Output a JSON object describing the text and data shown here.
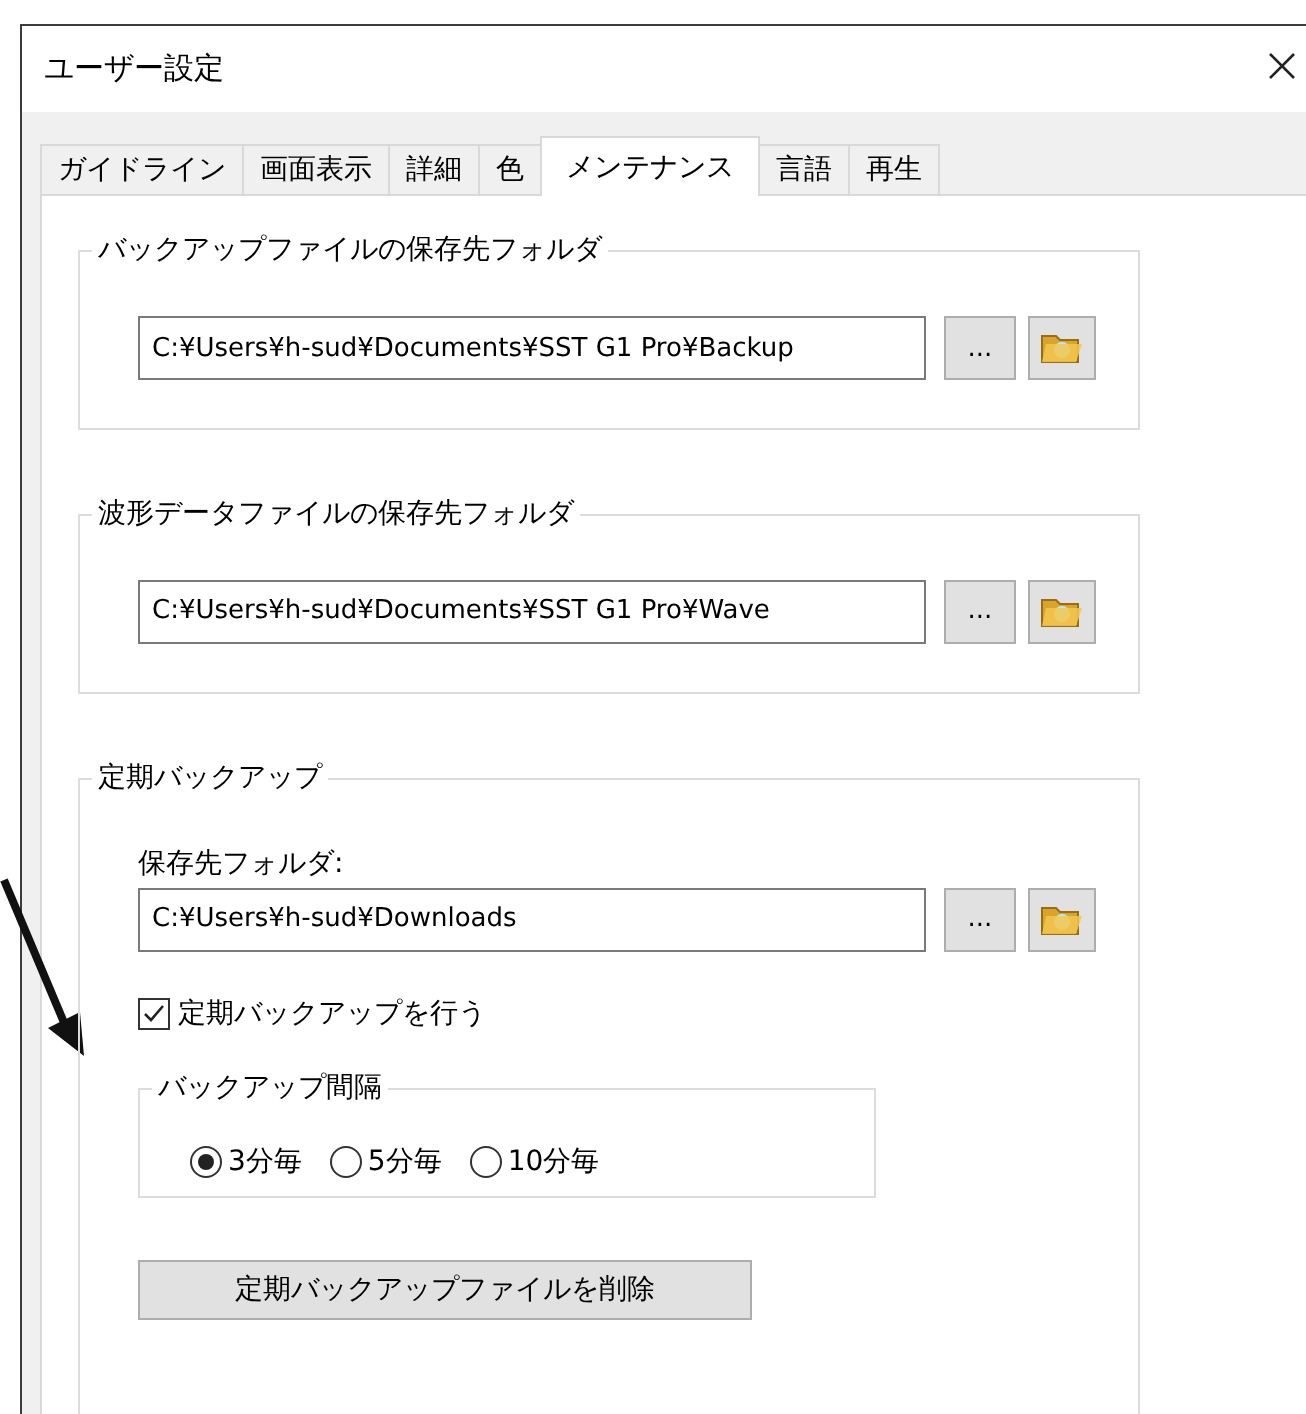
{
  "window": {
    "title": "ユーザー設定"
  },
  "tabs": [
    {
      "label": "ガイドライン",
      "selected": false
    },
    {
      "label": "画面表示",
      "selected": false
    },
    {
      "label": "詳細",
      "selected": false
    },
    {
      "label": "色",
      "selected": false
    },
    {
      "label": "メンテナンス",
      "selected": true
    },
    {
      "label": "言語",
      "selected": false
    },
    {
      "label": "再生",
      "selected": false
    }
  ],
  "groups": [
    {
      "kind": "path",
      "title": "バックアップファイルの保存先フォルダ",
      "path": "C:¥Users¥h-sud¥Documents¥SST G1 Pro¥Backup",
      "browse_button": "..."
    },
    {
      "kind": "path",
      "title": "波形データファイルの保存先フォルダ",
      "path": "C:¥Users¥h-sud¥Documents¥SST G1 Pro¥Wave",
      "browse_button": "..."
    },
    {
      "kind": "backup",
      "title": "定期バックアップ",
      "folder_label": "保存先フォルダ:",
      "path": "C:¥Users¥h-sud¥Downloads",
      "browse_button": "...",
      "enabled_label": "定期バックアップを行う",
      "enabled": true,
      "interval": {
        "title": "バックアップ間隔",
        "options": [
          {
            "label": "3分毎",
            "selected": true
          },
          {
            "label": "5分毎",
            "selected": false
          },
          {
            "label": "10分毎",
            "selected": false
          }
        ]
      },
      "delete_button": "定期バックアップファイルを削除"
    }
  ]
}
